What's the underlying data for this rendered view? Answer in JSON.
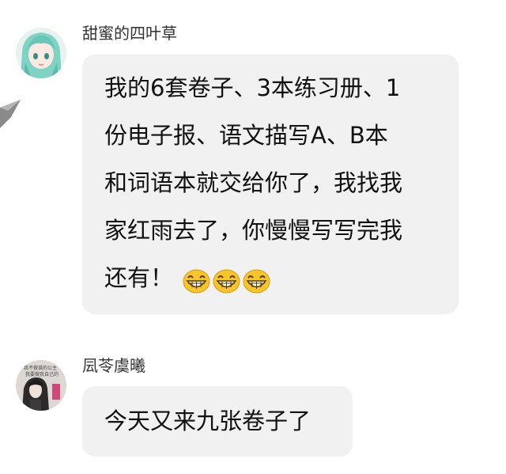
{
  "messages": [
    {
      "username": "甜蜜的四叶草",
      "lines": [
        "我的6套卷子、3本练习册、1",
        "份电子报、语文描写A、B本",
        "和词语本就交给你了，我找我",
        "家红雨去了，你慢慢写写完我",
        "还有！"
      ],
      "emojis": [
        "grin-emoji",
        "grin-emoji",
        "grin-emoji"
      ]
    },
    {
      "username": "凨苓虞曦",
      "lines": [
        "今天又来九张卷子了"
      ],
      "avatar_caption": "我不做谁的公主 我要做我自己的"
    }
  ],
  "colors": {
    "bubble": "#f1f1f1",
    "text": "#111111",
    "username": "#333333",
    "emoji": "#f6c42b"
  }
}
